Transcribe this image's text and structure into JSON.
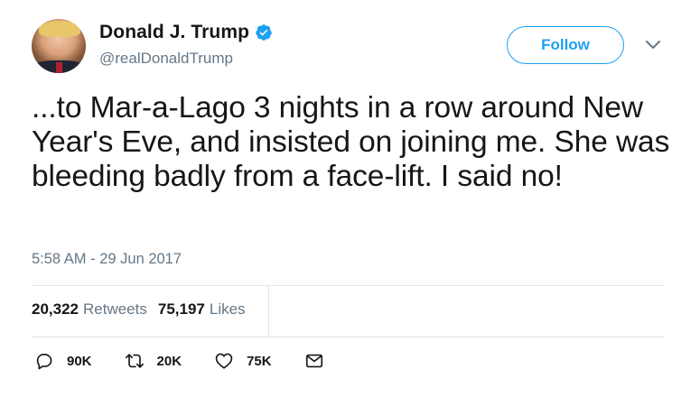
{
  "author": {
    "display_name": "Donald J. Trump",
    "handle": "@realDonaldTrump",
    "verified": true
  },
  "header": {
    "follow_label": "Follow"
  },
  "tweet": {
    "text": "...to Mar-a-Lago 3 nights in a row around New Year's Eve, and insisted on joining me. She was bleeding badly from a face-lift. I said no!",
    "timestamp": "5:58 AM - 29 Jun 2017"
  },
  "stats": {
    "retweets_count": "20,322",
    "retweets_label": "Retweets",
    "likes_count": "75,197",
    "likes_label": "Likes"
  },
  "actions": [
    {
      "icon": "reply-icon",
      "count": "90K"
    },
    {
      "icon": "retweet-icon",
      "count": "20K"
    },
    {
      "icon": "like-icon",
      "count": "75K"
    },
    {
      "icon": "message-icon",
      "count": ""
    }
  ],
  "colors": {
    "accent": "#1da1f2",
    "text": "#14171a",
    "secondary": "#657786",
    "divider": "#e1e8ed"
  }
}
